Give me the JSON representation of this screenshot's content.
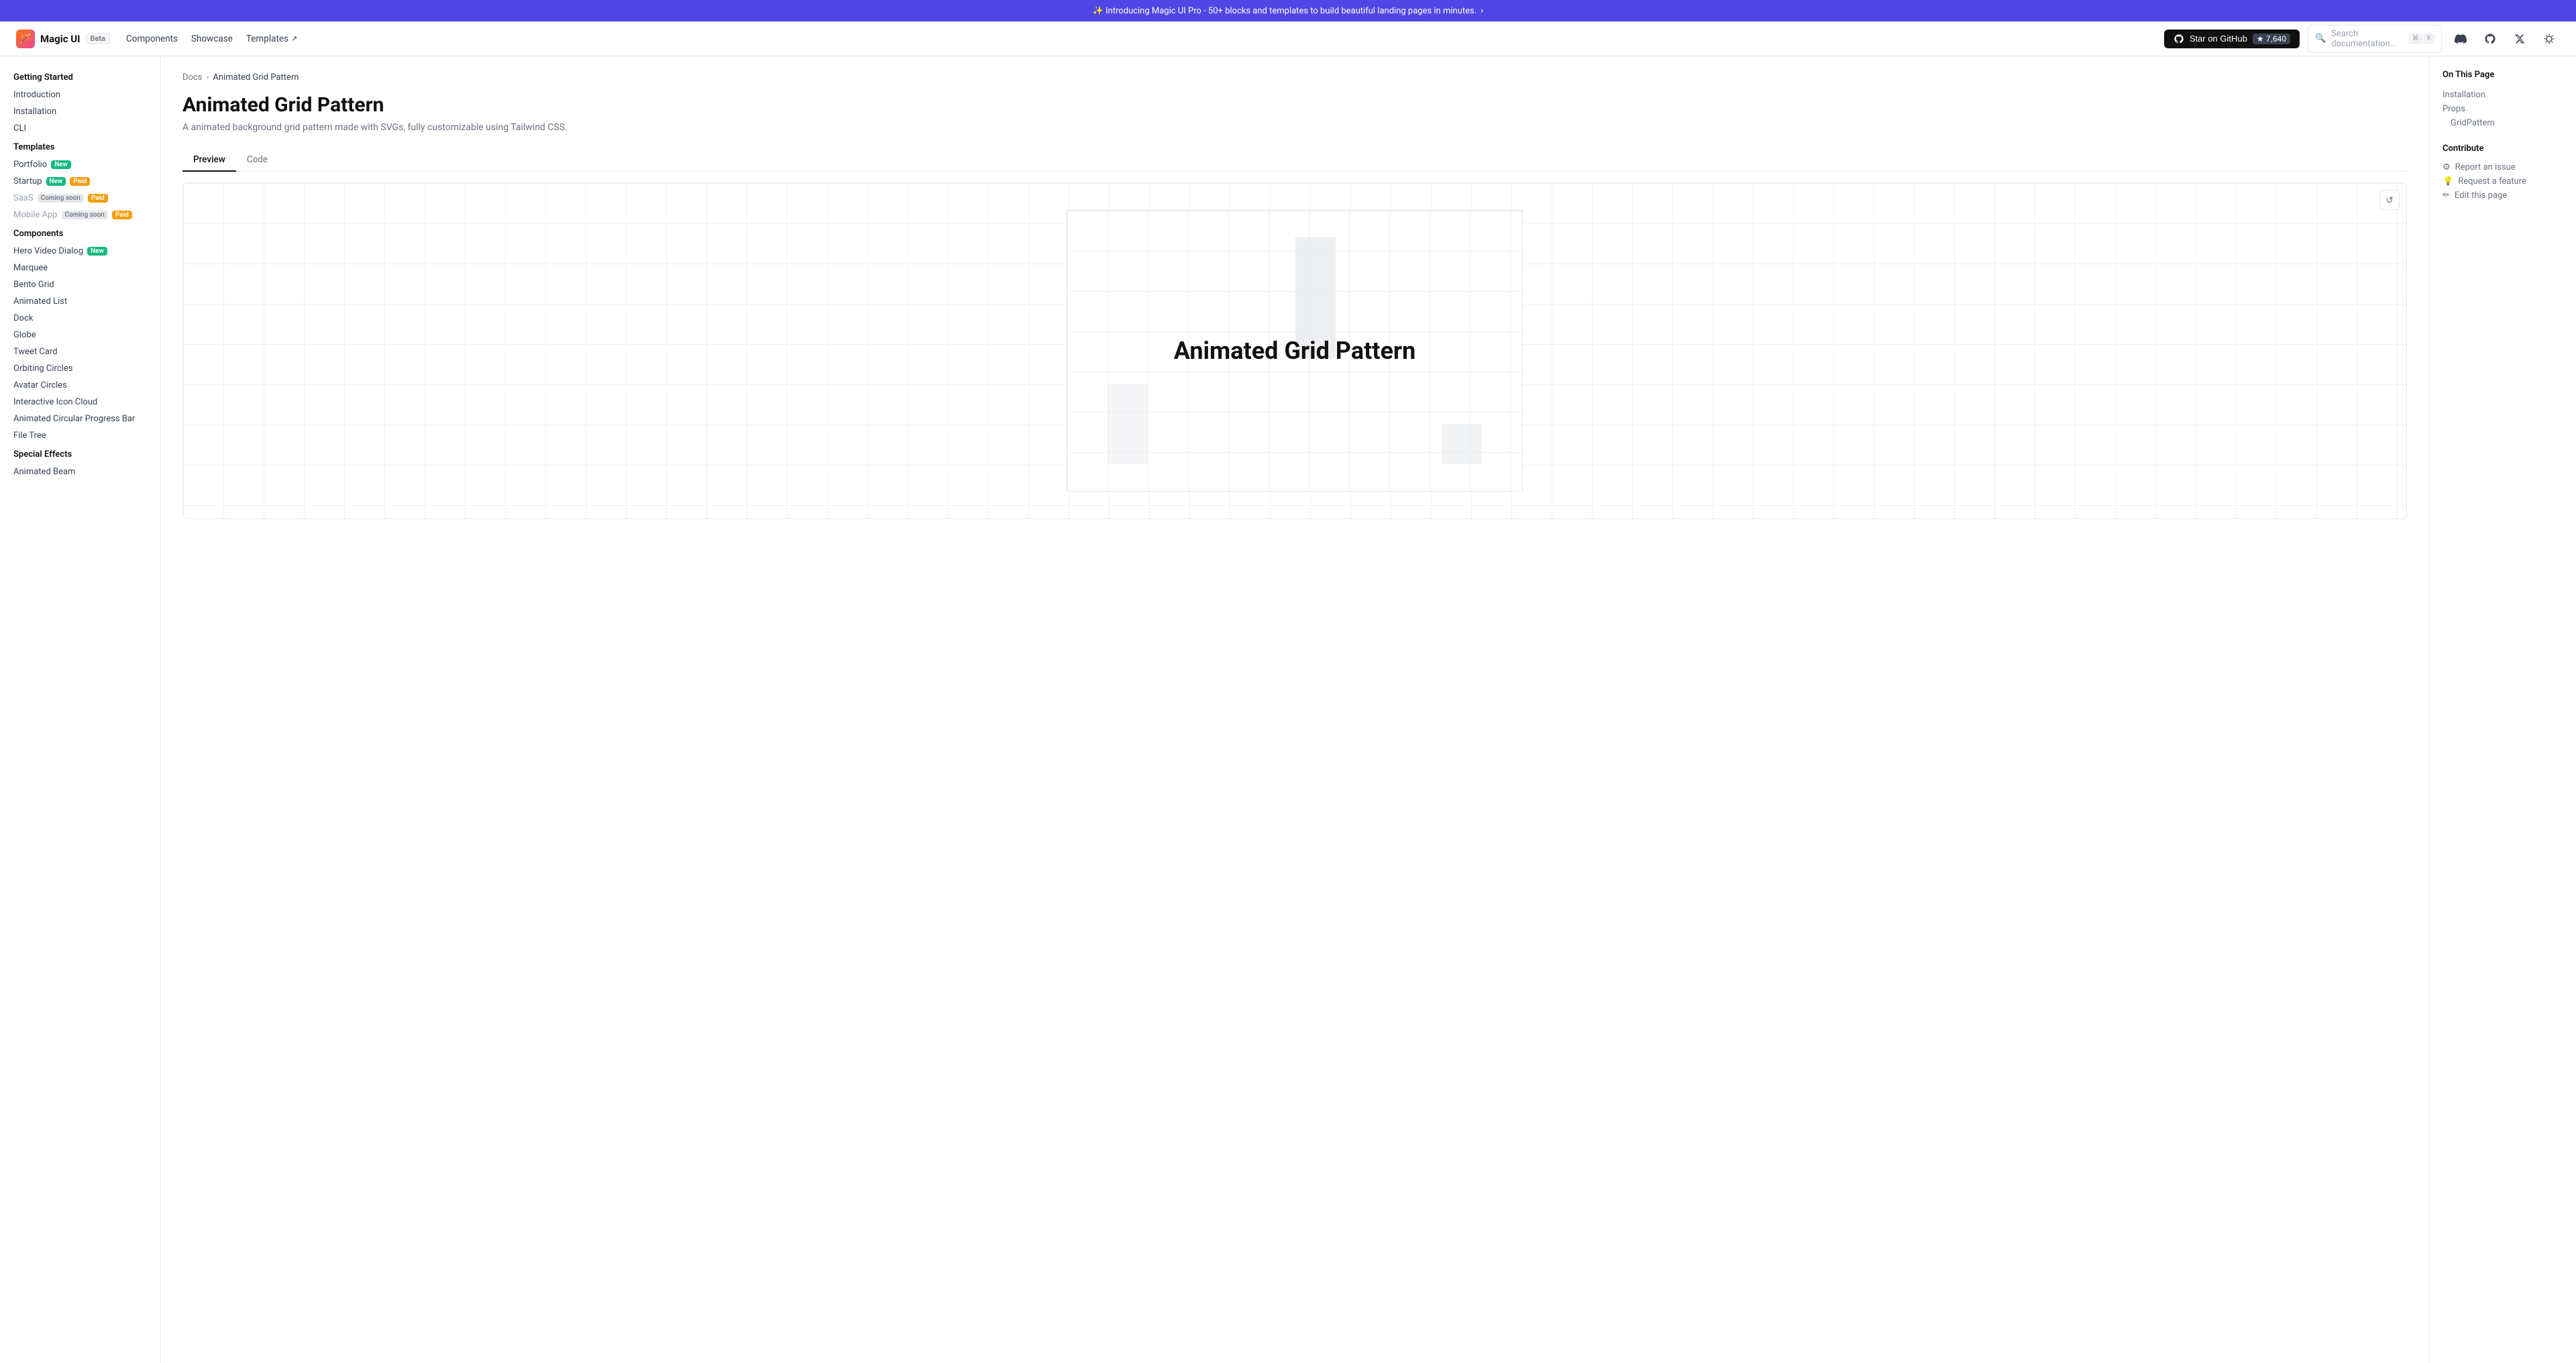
{
  "banner": {
    "text": "✨ Introducing Magic UI Pro - 50+ blocks and templates to build beautiful landing pages in minutes.",
    "arrow": "›"
  },
  "header": {
    "logo": "🪄",
    "brand": "Magic UI",
    "beta": "Beta",
    "nav": [
      {
        "label": "Components",
        "href": "#"
      },
      {
        "label": "Showcase",
        "href": "#"
      },
      {
        "label": "Templates",
        "href": "#",
        "external": true
      }
    ],
    "github_label": "Star on GitHub",
    "star_count": "7,640",
    "search_placeholder": "Search documentation...",
    "cmd_key": "⌘",
    "cmd_k": "K"
  },
  "sidebar": {
    "getting_started_title": "Getting Started",
    "getting_started_items": [
      {
        "label": "Introduction"
      },
      {
        "label": "Installation"
      },
      {
        "label": "CLI"
      }
    ],
    "templates_title": "Templates",
    "templates_items": [
      {
        "label": "Portfolio",
        "badge_new": true
      },
      {
        "label": "Startup",
        "badge_new": true,
        "badge_paid": true
      },
      {
        "label": "SaaS",
        "badge_coming": "Coming soon",
        "badge_paid": true,
        "muted": true
      },
      {
        "label": "Mobile App",
        "badge_coming": "Coming soon",
        "badge_paid": true,
        "muted": true
      }
    ],
    "components_title": "Components",
    "components_items": [
      {
        "label": "Hero Video Dialog",
        "badge_new": true
      },
      {
        "label": "Marquee"
      },
      {
        "label": "Bento Grid"
      },
      {
        "label": "Animated List"
      },
      {
        "label": "Dock"
      },
      {
        "label": "Globe"
      },
      {
        "label": "Tweet Card"
      },
      {
        "label": "Orbiting Circles"
      },
      {
        "label": "Avatar Circles"
      },
      {
        "label": "Interactive Icon Cloud"
      },
      {
        "label": "Animated Circular Progress Bar"
      },
      {
        "label": "File Tree"
      }
    ],
    "special_effects_title": "Special Effects",
    "special_effects_items": [
      {
        "label": "Animated Beam"
      }
    ]
  },
  "breadcrumb": {
    "root": "Docs",
    "current": "Animated Grid Pattern"
  },
  "page": {
    "title": "Animated Grid Pattern",
    "description": "A animated background grid pattern made with SVGs, fully customizable using Tailwind CSS.",
    "tabs": [
      {
        "label": "Preview",
        "active": true
      },
      {
        "label": "Code",
        "active": false
      }
    ],
    "preview_grid_title": "Animated Grid Pattern"
  },
  "toc": {
    "title": "On This Page",
    "links": [
      {
        "label": "Installation",
        "sub": false
      },
      {
        "label": "Props",
        "sub": false
      },
      {
        "label": "GridPattern",
        "sub": true
      }
    ],
    "contribute_title": "Contribute",
    "contribute_links": [
      {
        "label": "Report an issue",
        "icon": "⚙"
      },
      {
        "label": "Request a feature",
        "icon": "💡"
      },
      {
        "label": "Edit this page",
        "icon": "✏"
      }
    ]
  }
}
